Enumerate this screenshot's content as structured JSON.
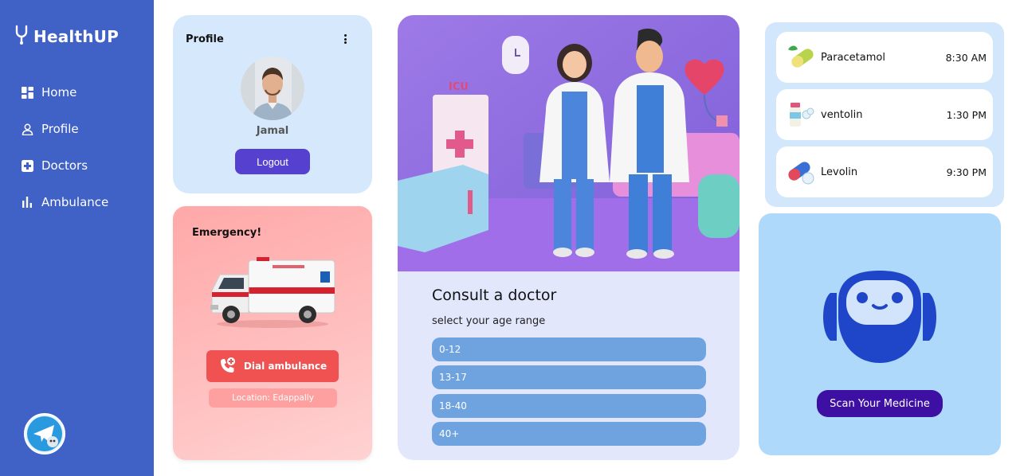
{
  "app": {
    "name": "HealthUP"
  },
  "sidebar": {
    "items": [
      {
        "label": "Home",
        "icon": "dashboard-icon"
      },
      {
        "label": "Profile",
        "icon": "user-icon"
      },
      {
        "label": "Doctors",
        "icon": "medical-cross-icon"
      },
      {
        "label": "Ambulance",
        "icon": "bar-chart-icon"
      }
    ]
  },
  "profile": {
    "title": "Profile",
    "name": "Jamal",
    "logout_label": "Logout"
  },
  "emergency": {
    "title": "Emergency!",
    "dial_label": "Dial ambulance",
    "location": "Location: Edappally"
  },
  "consult": {
    "title": "Consult a doctor",
    "subtitle": "select your age range",
    "hero_sign": "ICU",
    "age_ranges": [
      "0-12",
      "13-17",
      "18-40",
      "40+"
    ]
  },
  "medications": [
    {
      "name": "Paracetamol",
      "time": "8:30 AM",
      "icon": "pill-leaf-icon"
    },
    {
      "name": "ventolin",
      "time": "1:30 PM",
      "icon": "pill-bottle-icon"
    },
    {
      "name": "Levolin",
      "time": "9:30 PM",
      "icon": "capsule-icon"
    }
  ],
  "scanner": {
    "button_label": "Scan Your Medicine",
    "icon": "robot-icon"
  },
  "colors": {
    "sidebar": "#4061c5",
    "primary_button": "#5540cf",
    "emergency": "#f05252",
    "age_option": "#6ea3e0",
    "scan_button": "#3d0fa3",
    "robot": "#1f45c9"
  }
}
